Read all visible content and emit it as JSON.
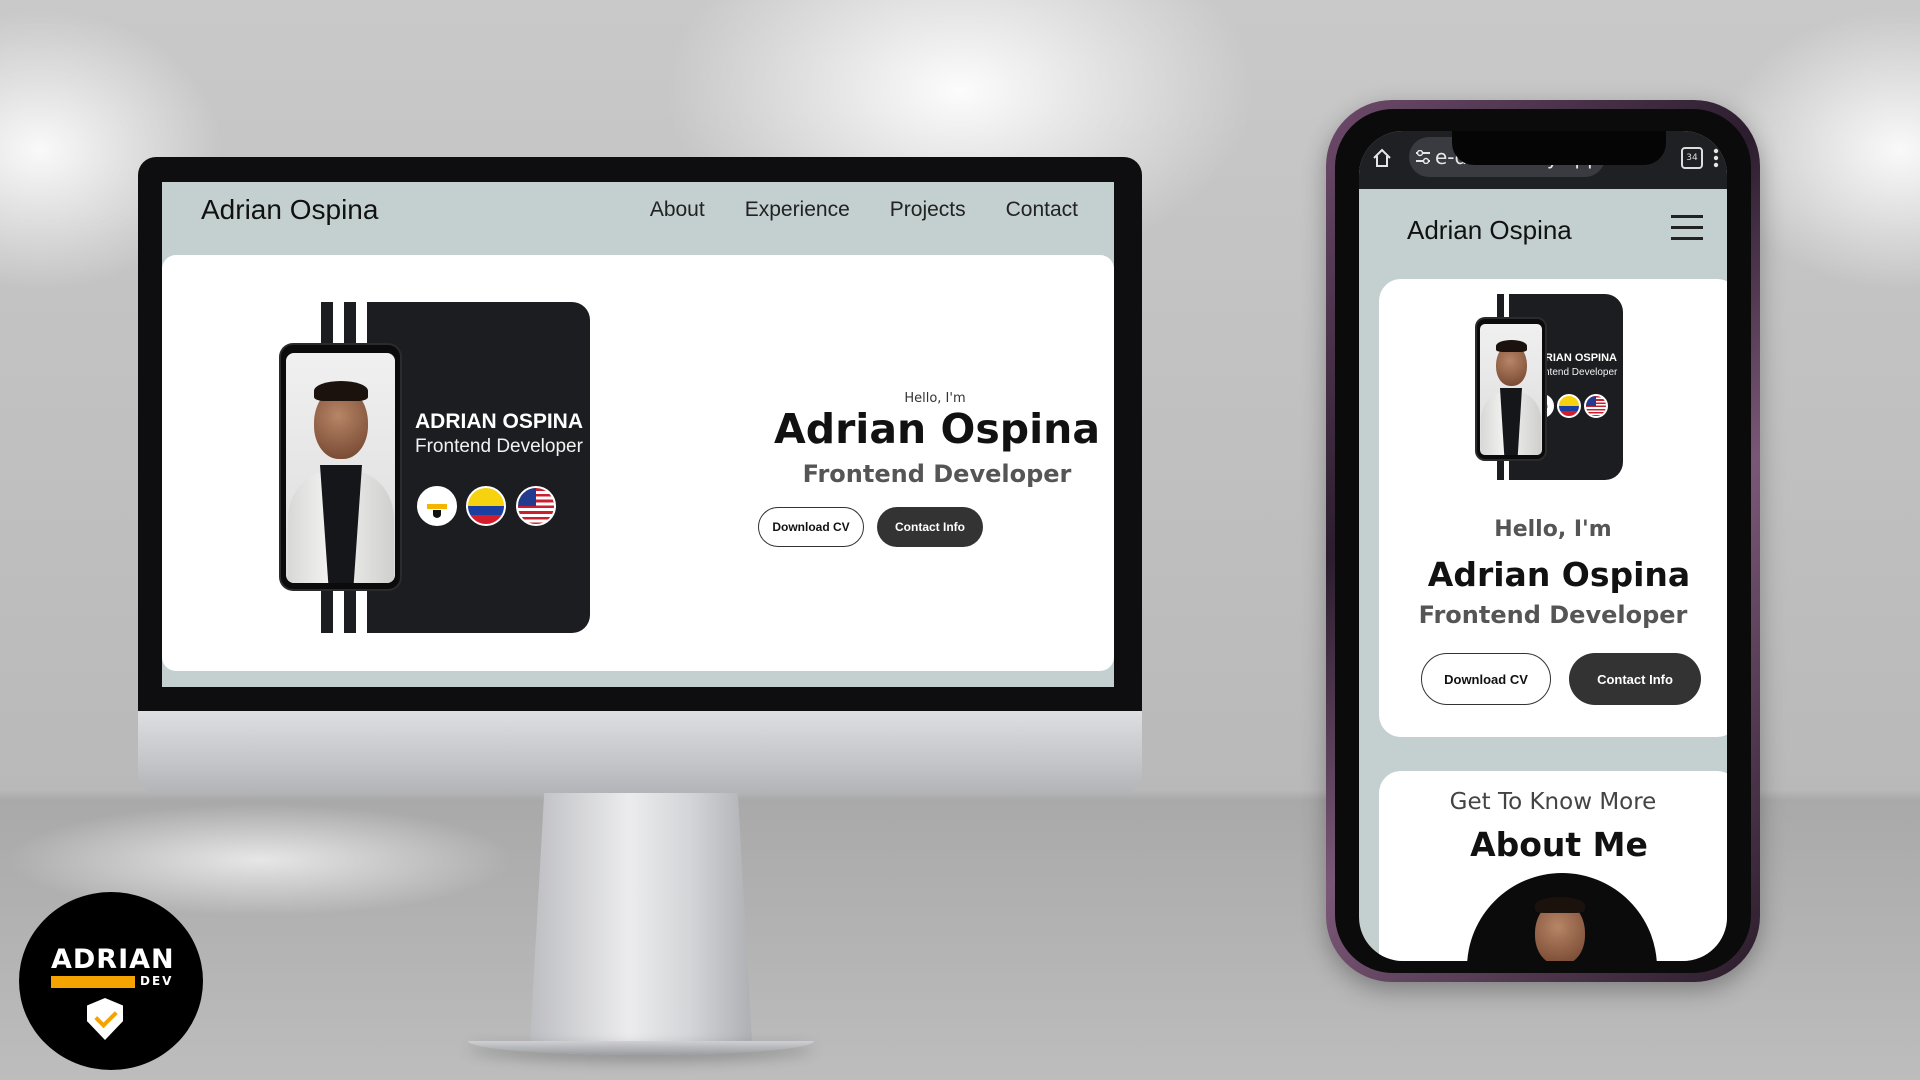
{
  "desktop": {
    "nav": {
      "brand": "Adrian Ospina",
      "links": [
        "About",
        "Experience",
        "Projects",
        "Contact"
      ]
    },
    "hero": {
      "image_name": "ADRIAN OSPINA",
      "image_role": "Frontend Developer",
      "hello": "Hello, I'm",
      "title": "Adrian Ospina",
      "role": "Frontend Developer",
      "download_cv": "Download CV",
      "contact_info": "Contact Info"
    }
  },
  "mobile": {
    "browser": {
      "url_fragment": "e-dev.netlify.app",
      "tab_count": "34"
    },
    "nav": {
      "brand": "Adrian Ospina"
    },
    "hero": {
      "image_name": "ADRIAN OSPINA",
      "image_role": "Frontend Developer",
      "hello": "Hello, I'm",
      "title": "Adrian Ospina",
      "role": "Frontend Developer",
      "download_cv": "Download CV",
      "contact_info": "Contact Info"
    },
    "about": {
      "subtitle": "Get To Know More",
      "title": "About Me"
    }
  },
  "logo": {
    "name": "ADRIAN",
    "suffix": "DEV"
  },
  "colors": {
    "site_background": "#c4d0d0",
    "button_dark": "#333333",
    "hero_dark": "#1c1d20",
    "logo_accent": "#f5a300"
  },
  "icons": [
    "home-icon",
    "site-settings-icon",
    "tabs-icon",
    "more-icon",
    "hamburger-menu-icon",
    "shield-check-icon"
  ]
}
